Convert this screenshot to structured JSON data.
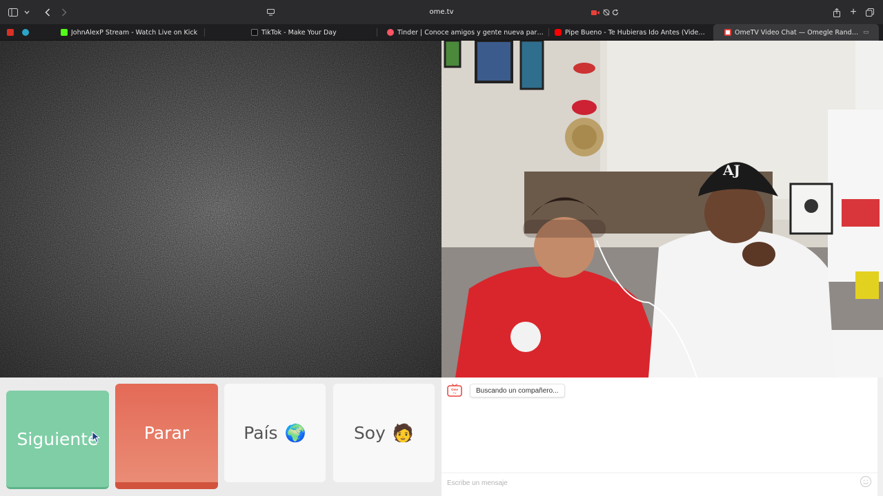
{
  "browser": {
    "url": "ome.tv",
    "tabs": [
      {
        "label": "JohnAlexP Stream - Watch Live on Kick",
        "favicon_color": "#53fc18",
        "active": false
      },
      {
        "label": "TikTok - Make Your Day",
        "favicon_color": "#111111",
        "active": false
      },
      {
        "label": "Tinder | Conoce amigos y gente nueva para salir",
        "favicon_color": "#fd5564",
        "active": false
      },
      {
        "label": "Pipe Bueno - Te Hubieras Ido Antes (Video Oficial...",
        "favicon_color": "#ff0000",
        "active": false
      },
      {
        "label": "OmeTV Video Chat — Omegle Random Cam...",
        "favicon_color": "#ffffff",
        "active": true
      }
    ],
    "icons": [
      "sidebar-icon",
      "chevron-down-icon",
      "back-icon",
      "forward-icon",
      "site-settings-icon",
      "camera-recording-icon",
      "reload-icon",
      "share-icon",
      "new-tab-icon",
      "tab-overview-icon"
    ]
  },
  "controls": {
    "next_label": "Siguiente",
    "stop_label": "Parar",
    "country_label": "País",
    "country_emoji": "🌍",
    "gender_label": "Soy",
    "gender_emoji": "🧑"
  },
  "chat": {
    "logo_text": "Ome TV",
    "status_message": "Buscando un compañero...",
    "input_placeholder": "Escribe un mensaje"
  },
  "colors": {
    "next": "#7fcea6",
    "stop": "#e36a56",
    "chrome": "#2b2b2d"
  }
}
